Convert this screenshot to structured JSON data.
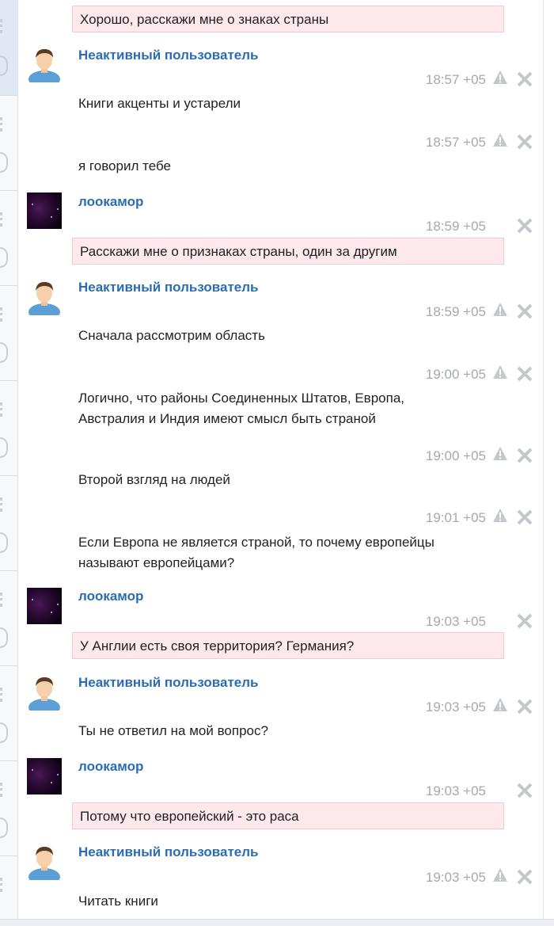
{
  "messages": [
    {
      "type": "quote",
      "text": "Хорошо, расскажи мне о знаках страны"
    },
    {
      "type": "author",
      "name": "Неактивный пользователь"
    },
    {
      "type": "time",
      "text": "18:57 +05"
    },
    {
      "type": "text",
      "text": "Книги акценты и устарели"
    },
    {
      "type": "time",
      "text": "18:57 +05"
    },
    {
      "type": "text",
      "text": "я говорил тебе"
    },
    {
      "type": "author",
      "name": "лоокамор"
    },
    {
      "type": "time",
      "text": "18:59 +05"
    },
    {
      "type": "quote",
      "text": "Расскажи мне о признаках страны, один за другим"
    },
    {
      "type": "author",
      "name": "Неактивный пользователь"
    },
    {
      "type": "time",
      "text": "18:59 +05"
    },
    {
      "type": "text",
      "text": "Сначала рассмотрим область"
    },
    {
      "type": "time",
      "text": "19:00 +05"
    },
    {
      "type": "text",
      "text": "Логично, что районы Соединенных Штатов, Европа, Австралия и Индия имеют смысл быть страной"
    },
    {
      "type": "time",
      "text": "19:00 +05"
    },
    {
      "type": "text",
      "text": "Второй взгляд на людей"
    },
    {
      "type": "time",
      "text": "19:01 +05"
    },
    {
      "type": "text",
      "text": "Если Европа не является страной, то почему европейцы называют европейцами?"
    },
    {
      "type": "author",
      "name": "лоокамор"
    },
    {
      "type": "time",
      "text": "19:03 +05"
    },
    {
      "type": "quote",
      "text": "У Англии есть своя территория? Германия?"
    },
    {
      "type": "author",
      "name": "Неактивный пользователь"
    },
    {
      "type": "time",
      "text": "19:03 +05"
    },
    {
      "type": "text",
      "text": "Ты не ответил на мой вопрос?"
    },
    {
      "type": "author",
      "name": "лоокамор"
    },
    {
      "type": "time",
      "text": "19:03 +05"
    },
    {
      "type": "quote",
      "text": "Потому что европейский - это раса"
    },
    {
      "type": "author",
      "name": "Неактивный пользователь"
    },
    {
      "type": "time",
      "text": "19:03 +05"
    },
    {
      "type": "text",
      "text": "Читать книги"
    }
  ],
  "icons": {
    "user_avatar": "user-avatar-icon",
    "space_avatar": "space-avatar",
    "warning": "warning-triangle-icon",
    "delete": "close-x-icon"
  },
  "colors": {
    "username": "#2b6cb3",
    "timestamp": "#a5a9ae",
    "quote_bg": "#fde9ec",
    "quote_border": "#f3c9cf",
    "icon_gray": "#c4c7cb"
  }
}
